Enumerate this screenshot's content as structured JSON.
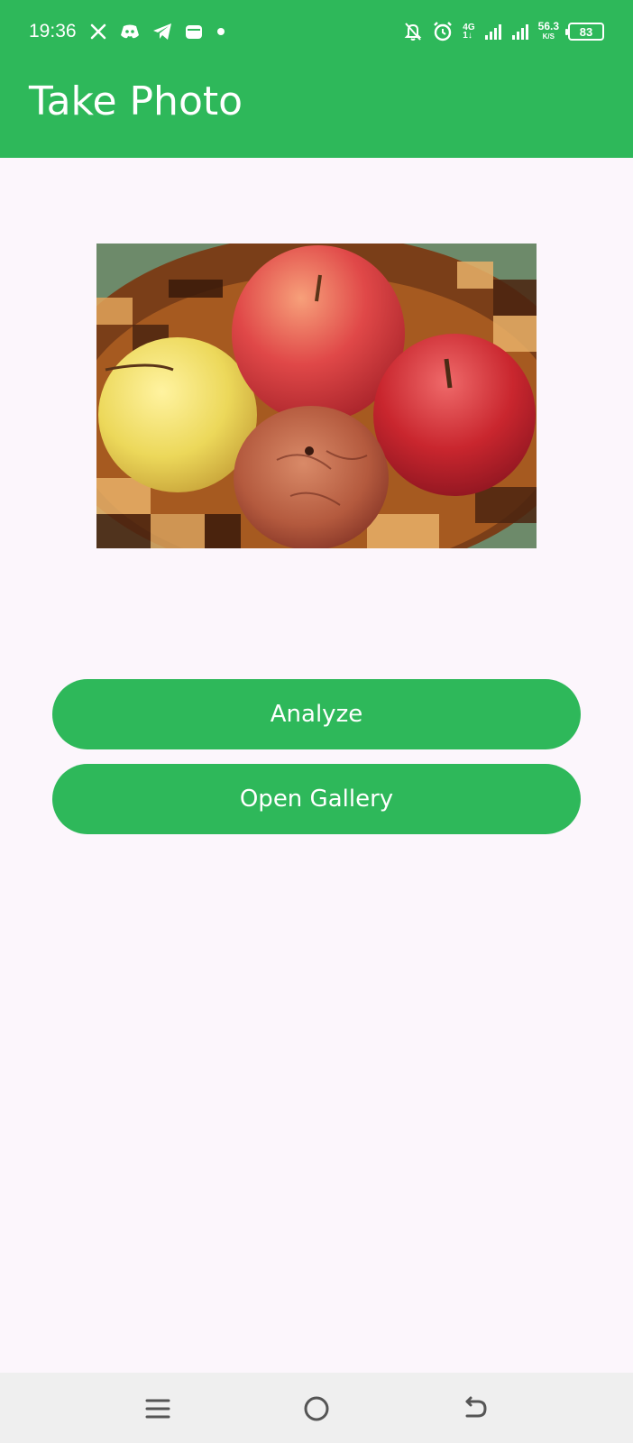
{
  "status_bar": {
    "time": "19:36",
    "left_icons": [
      "x-icon",
      "discord-icon",
      "telegram-icon",
      "wallet-icon",
      "dot-icon"
    ],
    "network_label_top": "4G",
    "network_label_bottom": "1↓",
    "speed_value": "56.3",
    "speed_unit": "K/S",
    "battery_level": "83"
  },
  "app_bar": {
    "title": "Take Photo"
  },
  "main": {
    "photo_icon": "apples-in-bowl-photo",
    "analyze_label": "Analyze",
    "gallery_label": "Open Gallery"
  },
  "nav_bar": {
    "icons": [
      "menu-icon",
      "home-icon",
      "back-icon"
    ]
  },
  "colors": {
    "primary": "#2eb85a",
    "background": "#fcf6fc",
    "nav_background": "#efefef"
  }
}
